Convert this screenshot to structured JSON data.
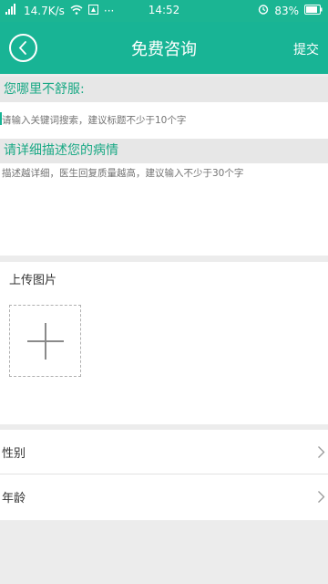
{
  "status_bar": {
    "network_speed": "14.7K/s",
    "time": "14:52",
    "battery": "83%"
  },
  "header": {
    "title": "免费咨询",
    "submit_label": "提交"
  },
  "form": {
    "question_label": "您哪里不舒服:",
    "question_placeholder": "请输入关键词搜索，建议标题不少于10个字",
    "detail_label": "请详细描述您的病情",
    "detail_placeholder": "描述越详细，医生回复质量越高，建议输入不少于30个字",
    "upload_label": "上传图片",
    "gender_label": "性别",
    "age_label": "年龄"
  },
  "colors": {
    "brand": "#18b495",
    "accent_text": "#1aa985"
  },
  "icons": {
    "back": "back-arrow-icon",
    "add": "plus-icon",
    "chevron": "chevron-right-icon"
  }
}
